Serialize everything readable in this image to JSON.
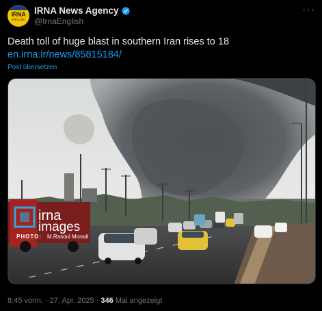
{
  "author": {
    "display_name": "IRNA News Agency",
    "handle": "@IrnaEnglish",
    "avatar_text": "IRNA",
    "avatar_subtext": "ENGLISH",
    "verified_color": "#1d9bf0"
  },
  "tweet": {
    "text": "Death toll of huge blast in southern Iran rises to 18",
    "link": "en.irna.ir/news/85815184/",
    "translate_label": "Post übersetzen"
  },
  "media": {
    "watermark_brand": "irna",
    "watermark_brand2": "images",
    "photo_credit_label": "PHOTO:",
    "photo_credit_name": "M.Rasoul Moradi"
  },
  "footer": {
    "time": "8:45 vorm.",
    "separator": "·",
    "date": "27. Apr. 2025",
    "separator2": "·",
    "views_count": "346",
    "views_label": "Mal angezeigt"
  },
  "colors": {
    "background": "#000000",
    "text": "#e7e9ea",
    "secondary": "#71767b",
    "accent": "#1d9bf0"
  },
  "icons": {
    "more": "more-dots-icon",
    "verified": "verified-badge-icon"
  }
}
